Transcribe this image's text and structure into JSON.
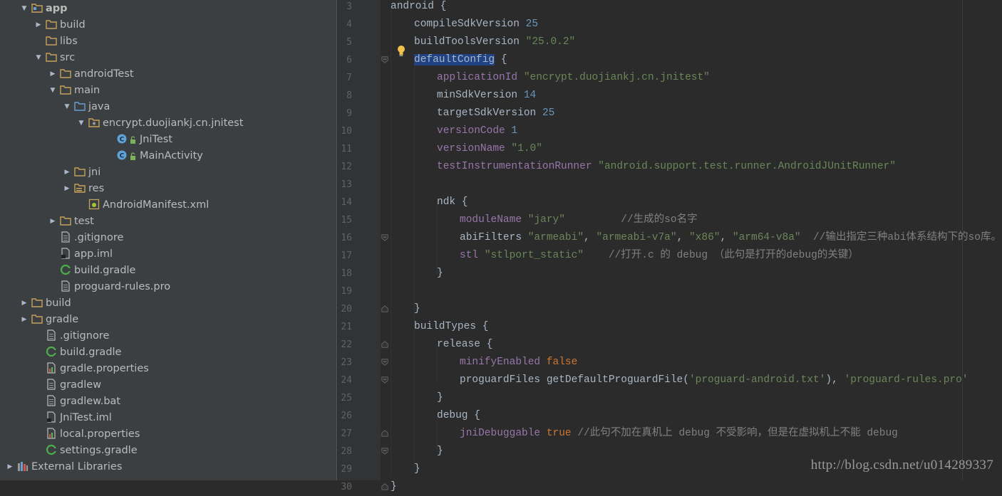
{
  "project_tree": {
    "items": [
      {
        "label": "app",
        "bold": true,
        "arrow": "open",
        "icon": "module-folder-icon"
      },
      {
        "label": "build",
        "arrow": "closed",
        "icon": "folder-icon"
      },
      {
        "label": "libs",
        "arrow": "none",
        "icon": "folder-icon"
      },
      {
        "label": "src",
        "arrow": "open",
        "icon": "folder-icon"
      },
      {
        "label": "androidTest",
        "arrow": "closed",
        "icon": "folder-icon"
      },
      {
        "label": "main",
        "arrow": "open",
        "icon": "folder-icon"
      },
      {
        "label": "java",
        "arrow": "open",
        "icon": "source-folder-icon"
      },
      {
        "label": "encrypt.duojiankj.cn.jnitest",
        "arrow": "open",
        "icon": "package-icon"
      },
      {
        "label": "JniTest",
        "arrow": "none",
        "icon": "java-class-icon"
      },
      {
        "label": "MainActivity",
        "arrow": "none",
        "icon": "java-class-icon"
      },
      {
        "label": "jni",
        "arrow": "closed",
        "icon": "folder-icon"
      },
      {
        "label": "res",
        "arrow": "closed",
        "icon": "resource-folder-icon"
      },
      {
        "label": "AndroidManifest.xml",
        "arrow": "none",
        "icon": "manifest-icon"
      },
      {
        "label": "test",
        "arrow": "closed",
        "icon": "folder-icon"
      },
      {
        "label": ".gitignore",
        "arrow": "none",
        "icon": "text-file-icon"
      },
      {
        "label": "app.iml",
        "arrow": "none",
        "icon": "iml-file-icon"
      },
      {
        "label": "build.gradle",
        "arrow": "none",
        "icon": "gradle-icon"
      },
      {
        "label": "proguard-rules.pro",
        "arrow": "none",
        "icon": "text-file-icon"
      },
      {
        "label": "build",
        "arrow": "closed",
        "icon": "folder-icon"
      },
      {
        "label": "gradle",
        "arrow": "closed",
        "icon": "folder-icon"
      },
      {
        "label": ".gitignore",
        "arrow": "none",
        "icon": "text-file-icon"
      },
      {
        "label": "build.gradle",
        "arrow": "none",
        "icon": "gradle-icon"
      },
      {
        "label": "gradle.properties",
        "arrow": "none",
        "icon": "properties-file-icon"
      },
      {
        "label": "gradlew",
        "arrow": "none",
        "icon": "text-file-icon"
      },
      {
        "label": "gradlew.bat",
        "arrow": "none",
        "icon": "text-file-icon"
      },
      {
        "label": "JniTest.iml",
        "arrow": "none",
        "icon": "iml-file-icon"
      },
      {
        "label": "local.properties",
        "arrow": "none",
        "icon": "properties-file-icon"
      },
      {
        "label": "settings.gradle",
        "arrow": "none",
        "icon": "gradle-icon"
      },
      {
        "label": "External Libraries",
        "arrow": "closed",
        "icon": "libraries-icon"
      }
    ]
  },
  "editor": {
    "lines": [
      {
        "n": "3",
        "code": [
          [
            "",
            "android {"
          ]
        ]
      },
      {
        "n": "4",
        "code": [
          [
            "",
            "compileSdkVersion "
          ],
          [
            "num",
            "25"
          ]
        ]
      },
      {
        "n": "5",
        "code": [
          [
            "",
            "buildToolsVersion "
          ],
          [
            "str",
            "\"25.0.2\""
          ]
        ]
      },
      {
        "n": "6",
        "code": [
          [
            "sel",
            "defaultConfig"
          ],
          [
            "",
            " {"
          ]
        ]
      },
      {
        "n": "7",
        "code": [
          [
            "prop",
            "applicationId "
          ],
          [
            "str",
            "\"encrypt.duojiankj.cn.jnitest\""
          ]
        ]
      },
      {
        "n": "8",
        "code": [
          [
            "",
            "minSdkVersion "
          ],
          [
            "num",
            "14"
          ]
        ]
      },
      {
        "n": "9",
        "code": [
          [
            "",
            "targetSdkVersion "
          ],
          [
            "num",
            "25"
          ]
        ]
      },
      {
        "n": "10",
        "code": [
          [
            "prop",
            "versionCode "
          ],
          [
            "num",
            "1"
          ]
        ]
      },
      {
        "n": "11",
        "code": [
          [
            "prop",
            "versionName "
          ],
          [
            "str",
            "\"1.0\""
          ]
        ]
      },
      {
        "n": "12",
        "code": [
          [
            "prop",
            "testInstrumentationRunner "
          ],
          [
            "str",
            "\"android.support.test.runner.AndroidJUnitRunner\""
          ]
        ]
      },
      {
        "n": "13",
        "code": []
      },
      {
        "n": "14",
        "code": [
          [
            "",
            "ndk {"
          ]
        ]
      },
      {
        "n": "15",
        "code": [
          [
            "prop",
            "moduleName "
          ],
          [
            "str",
            "\"jary\""
          ],
          [
            "",
            "         "
          ],
          [
            "cmt",
            "//生成的so名字"
          ]
        ]
      },
      {
        "n": "16",
        "code": [
          [
            "",
            "abiFilters "
          ],
          [
            "str",
            "\"armeabi\""
          ],
          [
            "",
            ", "
          ],
          [
            "str",
            "\"armeabi-v7a\""
          ],
          [
            "",
            ", "
          ],
          [
            "str",
            "\"x86\""
          ],
          [
            "",
            ", "
          ],
          [
            "str",
            "\"arm64-v8a\""
          ],
          [
            "",
            "  "
          ],
          [
            "cmt",
            "//输出指定三种abi体系结构下的so库。"
          ]
        ]
      },
      {
        "n": "17",
        "code": [
          [
            "prop",
            "stl "
          ],
          [
            "str",
            "\"stlport_static\""
          ],
          [
            "",
            "    "
          ],
          [
            "cmt",
            "//打开.c 的 debug （此句是打开的debug的关键）"
          ]
        ]
      },
      {
        "n": "18",
        "code": [
          [
            "",
            "}"
          ]
        ]
      },
      {
        "n": "19",
        "code": []
      },
      {
        "n": "20",
        "code": [
          [
            "",
            "}"
          ]
        ]
      },
      {
        "n": "21",
        "code": [
          [
            "",
            "buildTypes {"
          ]
        ]
      },
      {
        "n": "22",
        "code": [
          [
            "",
            "release {"
          ]
        ]
      },
      {
        "n": "23",
        "code": [
          [
            "prop",
            "minifyEnabled "
          ],
          [
            "kw",
            "false"
          ]
        ]
      },
      {
        "n": "24",
        "code": [
          [
            "",
            "proguardFiles getDefaultProguardFile("
          ],
          [
            "str",
            "'proguard-android.txt'"
          ],
          [
            "",
            "), "
          ],
          [
            "str",
            "'proguard-rules.pro'"
          ]
        ]
      },
      {
        "n": "25",
        "code": [
          [
            "",
            "}"
          ]
        ]
      },
      {
        "n": "26",
        "code": [
          [
            "",
            "debug {"
          ]
        ]
      },
      {
        "n": "27",
        "code": [
          [
            "prop",
            "jniDebuggable "
          ],
          [
            "kw",
            "true"
          ],
          [
            "",
            ""
          ],
          [
            "cmt",
            " //此句不加在真机上 debug 不受影响，但是在虚拟机上不能 debug"
          ]
        ]
      },
      {
        "n": "28",
        "code": [
          [
            "",
            "}"
          ]
        ]
      },
      {
        "n": "29",
        "code": [
          [
            "",
            "}"
          ]
        ]
      },
      {
        "n": "30",
        "code": [
          [
            "",
            "}"
          ]
        ]
      }
    ]
  },
  "watermark": "http://blog.csdn.net/u014289337",
  "colors": {
    "keyword": "#cc7832",
    "property": "#9876aa",
    "string": "#6a8759",
    "number": "#6897bb",
    "comment": "#808080",
    "selection": "#214283"
  }
}
